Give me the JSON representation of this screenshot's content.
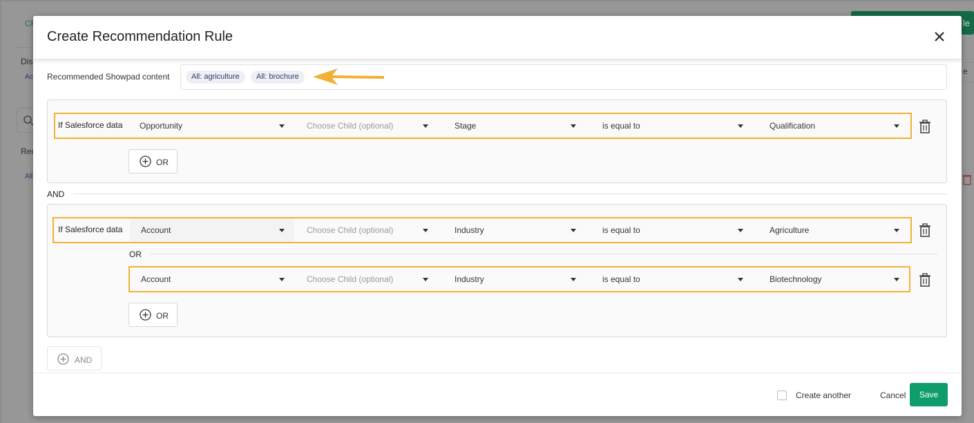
{
  "background": {
    "top_left_text": "CR",
    "dis_label": "Dis",
    "ac_label": "Ac",
    "rec_label": "Rec",
    "all_label": "All",
    "btn_fragment": "le",
    "right_fragment": "e"
  },
  "modal": {
    "title": "Create Recommendation Rule"
  },
  "content": {
    "label": "Recommended Showpad content",
    "tags": [
      "All: agriculture",
      "All: brochure"
    ]
  },
  "groups": [
    {
      "rows": [
        {
          "prefix": "If Salesforce data",
          "object": "Opportunity",
          "child_placeholder": "Choose Child (optional)",
          "field": "Stage",
          "operator": "is equal to",
          "value": "Qualification"
        }
      ],
      "or_button": "OR"
    },
    {
      "rows": [
        {
          "prefix": "If Salesforce data",
          "object": "Account",
          "child_placeholder": "Choose Child (optional)",
          "field": "Industry",
          "operator": "is equal to",
          "value": "Agriculture"
        },
        {
          "prefix": "",
          "object": "Account",
          "child_placeholder": "Choose Child (optional)",
          "field": "Industry",
          "operator": "is equal to",
          "value": "Biotechnology"
        }
      ],
      "or_separator": "OR",
      "or_button": "OR"
    }
  ],
  "and_separator": "AND",
  "add_and_button": "AND",
  "footer": {
    "create_another": "Create another",
    "cancel": "Cancel",
    "save": "Save"
  },
  "colors": {
    "highlight": "#f2b134",
    "save": "#0f9d6b",
    "tag_text": "#2c3a6b"
  }
}
